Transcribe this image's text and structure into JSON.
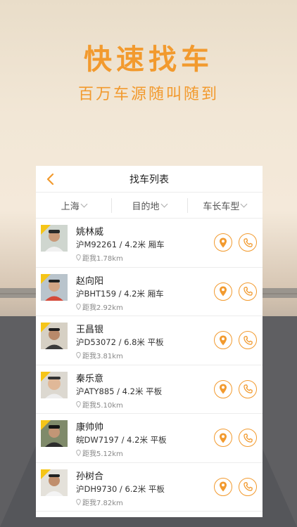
{
  "hero": {
    "title": "快速找车",
    "subtitle": "百万车源随叫随到"
  },
  "header": {
    "title": "找车列表",
    "back_icon": "chevron-left-icon"
  },
  "filters": [
    {
      "label": "上海"
    },
    {
      "label": "目的地"
    },
    {
      "label": "车长车型"
    }
  ],
  "drivers": [
    {
      "name": "姚林威",
      "info": "沪M92261 / 4.2米 厢车",
      "distance": "距我1.78km"
    },
    {
      "name": "赵向阳",
      "info": "沪BHT159 / 4.2米 厢车",
      "distance": "距我2.92km"
    },
    {
      "name": "王昌银",
      "info": "沪D53072 / 6.8米 平板",
      "distance": "距我3.81km"
    },
    {
      "name": "秦乐意",
      "info": "沪ATY885 / 4.2米 平板",
      "distance": "距我5.10km"
    },
    {
      "name": "康帅帅",
      "info": "皖DW7197 / 4.2米 平板",
      "distance": "距我5.12km"
    },
    {
      "name": "孙树合",
      "info": "沪DH9730 / 6.2米 平板",
      "distance": "距我7.82km"
    }
  ],
  "colors": {
    "accent": "#f29a2e",
    "badge": "#f5c518"
  }
}
